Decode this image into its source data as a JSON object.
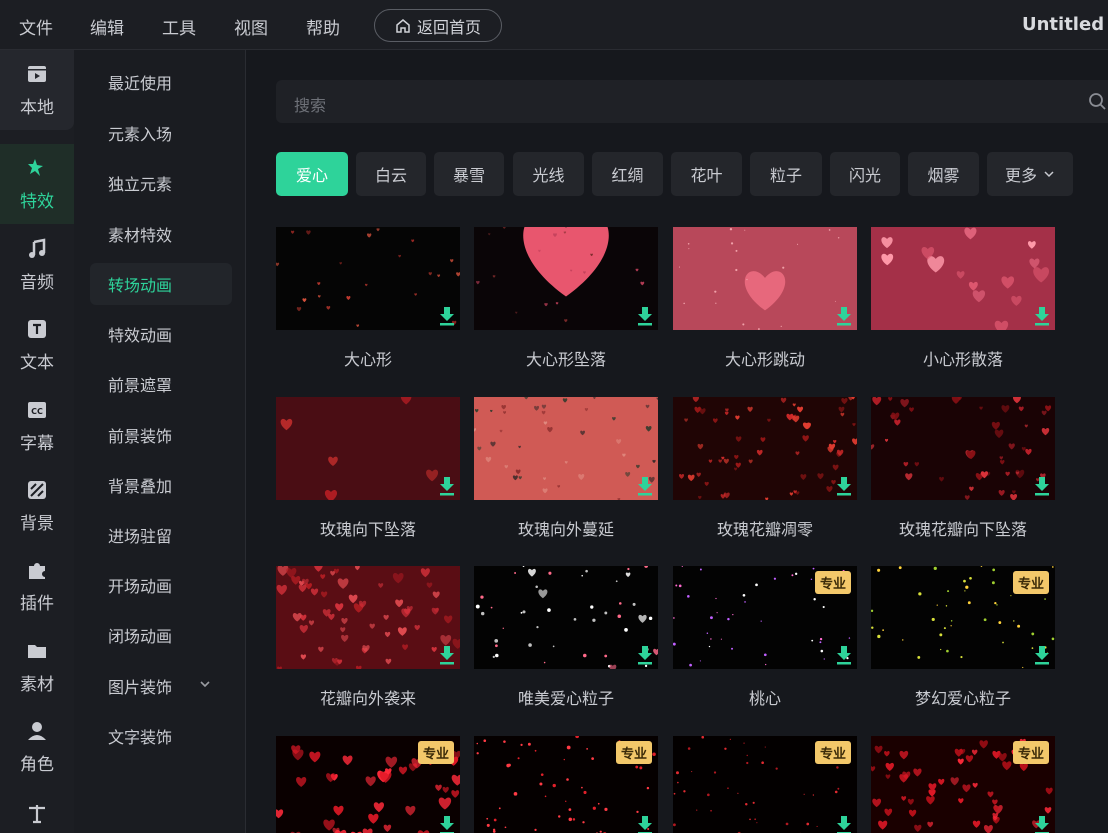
{
  "menubar": {
    "items": [
      "文件",
      "编辑",
      "工具",
      "视图",
      "帮助"
    ],
    "home_label": "返回首页",
    "title": "Untitled"
  },
  "rail": {
    "items": [
      {
        "label": "本地",
        "icon": "film-icon"
      },
      {
        "label": "特效",
        "icon": "magic-star-icon"
      },
      {
        "label": "音频",
        "icon": "music-note-icon"
      },
      {
        "label": "文本",
        "icon": "text-t-icon"
      },
      {
        "label": "字幕",
        "icon": "cc-icon"
      },
      {
        "label": "背景",
        "icon": "background-stripes-icon"
      },
      {
        "label": "插件",
        "icon": "puzzle-icon"
      },
      {
        "label": "素材",
        "icon": "folder-icon"
      },
      {
        "label": "角色",
        "icon": "person-icon"
      },
      {
        "label": "…",
        "icon": "balance-icon"
      }
    ],
    "active_index": 1
  },
  "categories": {
    "items": [
      "最近使用",
      "元素入场",
      "独立元素",
      "素材特效",
      "转场动画",
      "特效动画",
      "前景遮罩",
      "前景装饰",
      "背景叠加",
      "进场驻留",
      "开场动画",
      "闭场动画",
      "图片装饰",
      "文字装饰"
    ],
    "active_index": 4,
    "expandable_index": 12
  },
  "search": {
    "placeholder": "搜索"
  },
  "chips": {
    "items": [
      "爱心",
      "白云",
      "暴雪",
      "光线",
      "红绸",
      "花叶",
      "粒子",
      "闪光",
      "烟雾",
      "更多"
    ],
    "active_index": 0
  },
  "grid": {
    "pro_label": "专业",
    "items": [
      {
        "name": "大心形",
        "pro": false
      },
      {
        "name": "大心形坠落",
        "pro": false
      },
      {
        "name": "大心形跳动",
        "pro": false
      },
      {
        "name": "小心形散落",
        "pro": false
      },
      {
        "name": "玫瑰向下坠落",
        "pro": false
      },
      {
        "name": "玫瑰向外蔓延",
        "pro": false
      },
      {
        "name": "玫瑰花瓣凋零",
        "pro": false
      },
      {
        "name": "玫瑰花瓣向下坠落",
        "pro": false
      },
      {
        "name": "花瓣向外袭来",
        "pro": false
      },
      {
        "name": "唯美爱心粒子",
        "pro": false
      },
      {
        "name": "桃心",
        "pro": true
      },
      {
        "name": "梦幻爱心粒子",
        "pro": true
      },
      {
        "name": "",
        "pro": true
      },
      {
        "name": "",
        "pro": true
      },
      {
        "name": "",
        "pro": true
      },
      {
        "name": "",
        "pro": true
      }
    ]
  },
  "colors": {
    "accent": "#2ed39a",
    "pro_badge": "#f3c86a",
    "background": "#16181d"
  }
}
